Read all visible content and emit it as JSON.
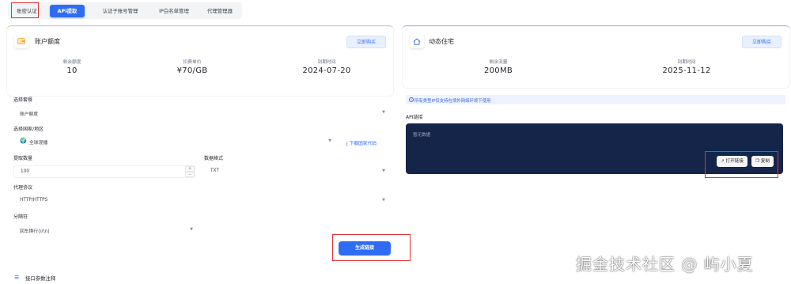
{
  "tabs": [
    {
      "label": "账密认证",
      "active": false
    },
    {
      "label": "API提取",
      "active": true
    },
    {
      "label": "认证子账号管理",
      "active": false
    },
    {
      "label": "IP白名单管理",
      "active": false
    },
    {
      "label": "代理管理器",
      "active": false
    }
  ],
  "account_card": {
    "title": "账户额度",
    "buy_label": "立即购买",
    "stats": [
      {
        "label": "剩余额度",
        "value": "10"
      },
      {
        "label": "扣费单价",
        "value": "¥70/GB"
      },
      {
        "label": "到期时间",
        "value": "2024-07-20"
      }
    ]
  },
  "residential_card": {
    "title": "动态住宅",
    "buy_label": "立即购买",
    "stats": [
      {
        "label": "剩余流量",
        "value": "200MB"
      },
      {
        "label": "到期时间",
        "value": "2025-11-12"
      }
    ]
  },
  "form": {
    "package_label": "选择套餐",
    "package_value": "账户额度",
    "country_label": "选择国家/地区",
    "country_value": "全球混播",
    "download_codes_label": "下载国家代码",
    "quantity_label": "提取数量",
    "quantity_value": "100",
    "format_label": "数据格式",
    "format_value": "TXT",
    "protocol_label": "代理协议",
    "protocol_value": "HTTP/HTTPS",
    "separator_label": "分隔符",
    "separator_value": "回车换行(\\r\\n)",
    "generate_label": "生成链接"
  },
  "api": {
    "notice": "所有类型IP仅支持在境外网络环境下使用",
    "link_label": "API链接",
    "empty_text": "暂无数据",
    "open_label": "打开链接",
    "copy_label": "复制"
  },
  "bottom": {
    "params_label": "接口参数注释"
  },
  "watermark": "掘金技术社区 @ 屿小夏",
  "colors": {
    "accent": "#2f6cf6",
    "api_box_bg": "#142549",
    "highlight_border": "#e0322f"
  }
}
